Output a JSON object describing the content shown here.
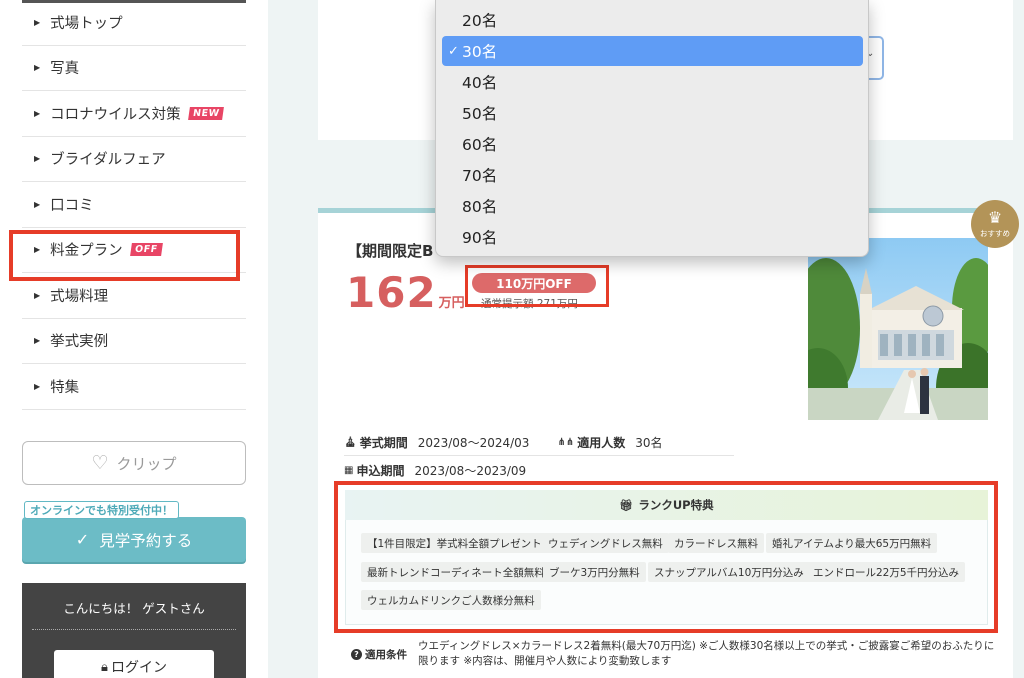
{
  "sidebar": {
    "menu": [
      {
        "label": "式場トップ",
        "badge": ""
      },
      {
        "label": "写真",
        "badge": ""
      },
      {
        "label": "コロナウイルス対策",
        "badge": "NEW"
      },
      {
        "label": "ブライダルフェア",
        "badge": ""
      },
      {
        "label": "口コミ",
        "badge": ""
      },
      {
        "label": "料金プラン",
        "badge": "OFF"
      },
      {
        "label": "式場料理",
        "badge": ""
      },
      {
        "label": "挙式実例",
        "badge": ""
      },
      {
        "label": "特集",
        "badge": ""
      }
    ],
    "clip_label": "クリップ",
    "tour_badge": "オンラインでも特別受付中！",
    "tour_label": "見学予約する",
    "guest_greeting": "こんにちは！ ゲストさん",
    "login_label": "ログイン"
  },
  "dropdown": {
    "options": [
      "20名",
      "30名",
      "40名",
      "50名",
      "60名",
      "70名",
      "80名",
      "90名"
    ],
    "selected_index": 1,
    "selected_value": "30名"
  },
  "plan": {
    "title": "【期間限定B",
    "recommend_label": "おすすめ",
    "price_number": "162",
    "price_unit": "万円",
    "discount_label": "110万円OFF",
    "regular_price": "通常提示額 271万円",
    "ceremony_period_label": "挙式期間",
    "ceremony_period": "2023/08〜2024/03",
    "guests_label": "適用人数",
    "guests": "30名",
    "application_period_label": "申込期間",
    "application_period": "2023/08〜2023/09",
    "rank_title": "ランクUP特典",
    "benefits": [
      "【1件目限定】挙式料全額プレゼント",
      "ウェディングドレス無料",
      "カラードレス無料",
      "婚礼アイテムより最大65万円無料",
      "最新トレンドコーディネート全額無料",
      "ブーケ3万円分無料",
      "スナップアルバム10万円分込み",
      "エンドロール22万5千円分込み",
      "ウェルカムドリンクご人数様分無料"
    ],
    "conditions_label": "適用条件",
    "conditions_text": "ウエディングドレス×カラードレス2着無料(最大70万円迄) ※ご人数様30名様以上での挙式・ご披露宴ご希望のおふたりに限ります ※内容は、開催月や人数により変動致します"
  },
  "colors": {
    "accent_teal": "#6cbcc6",
    "price_red": "#d65f5f",
    "highlight_red": "#e63c28",
    "select_blue": "#5f9cf5",
    "recommend_gold": "#b39458"
  }
}
